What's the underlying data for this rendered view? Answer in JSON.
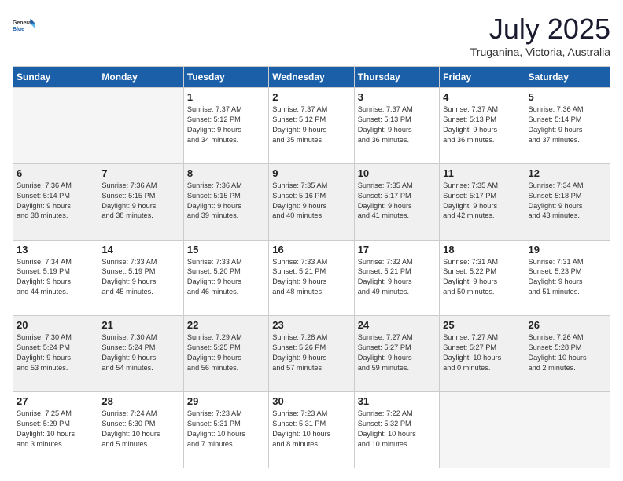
{
  "header": {
    "logo_line1": "General",
    "logo_line2": "Blue",
    "month_title": "July 2025",
    "location": "Truganina, Victoria, Australia"
  },
  "days_of_week": [
    "Sunday",
    "Monday",
    "Tuesday",
    "Wednesday",
    "Thursday",
    "Friday",
    "Saturday"
  ],
  "weeks": [
    [
      {
        "day": "",
        "info": ""
      },
      {
        "day": "",
        "info": ""
      },
      {
        "day": "1",
        "info": "Sunrise: 7:37 AM\nSunset: 5:12 PM\nDaylight: 9 hours\nand 34 minutes."
      },
      {
        "day": "2",
        "info": "Sunrise: 7:37 AM\nSunset: 5:12 PM\nDaylight: 9 hours\nand 35 minutes."
      },
      {
        "day": "3",
        "info": "Sunrise: 7:37 AM\nSunset: 5:13 PM\nDaylight: 9 hours\nand 36 minutes."
      },
      {
        "day": "4",
        "info": "Sunrise: 7:37 AM\nSunset: 5:13 PM\nDaylight: 9 hours\nand 36 minutes."
      },
      {
        "day": "5",
        "info": "Sunrise: 7:36 AM\nSunset: 5:14 PM\nDaylight: 9 hours\nand 37 minutes."
      }
    ],
    [
      {
        "day": "6",
        "info": "Sunrise: 7:36 AM\nSunset: 5:14 PM\nDaylight: 9 hours\nand 38 minutes."
      },
      {
        "day": "7",
        "info": "Sunrise: 7:36 AM\nSunset: 5:15 PM\nDaylight: 9 hours\nand 38 minutes."
      },
      {
        "day": "8",
        "info": "Sunrise: 7:36 AM\nSunset: 5:15 PM\nDaylight: 9 hours\nand 39 minutes."
      },
      {
        "day": "9",
        "info": "Sunrise: 7:35 AM\nSunset: 5:16 PM\nDaylight: 9 hours\nand 40 minutes."
      },
      {
        "day": "10",
        "info": "Sunrise: 7:35 AM\nSunset: 5:17 PM\nDaylight: 9 hours\nand 41 minutes."
      },
      {
        "day": "11",
        "info": "Sunrise: 7:35 AM\nSunset: 5:17 PM\nDaylight: 9 hours\nand 42 minutes."
      },
      {
        "day": "12",
        "info": "Sunrise: 7:34 AM\nSunset: 5:18 PM\nDaylight: 9 hours\nand 43 minutes."
      }
    ],
    [
      {
        "day": "13",
        "info": "Sunrise: 7:34 AM\nSunset: 5:19 PM\nDaylight: 9 hours\nand 44 minutes."
      },
      {
        "day": "14",
        "info": "Sunrise: 7:33 AM\nSunset: 5:19 PM\nDaylight: 9 hours\nand 45 minutes."
      },
      {
        "day": "15",
        "info": "Sunrise: 7:33 AM\nSunset: 5:20 PM\nDaylight: 9 hours\nand 46 minutes."
      },
      {
        "day": "16",
        "info": "Sunrise: 7:33 AM\nSunset: 5:21 PM\nDaylight: 9 hours\nand 48 minutes."
      },
      {
        "day": "17",
        "info": "Sunrise: 7:32 AM\nSunset: 5:21 PM\nDaylight: 9 hours\nand 49 minutes."
      },
      {
        "day": "18",
        "info": "Sunrise: 7:31 AM\nSunset: 5:22 PM\nDaylight: 9 hours\nand 50 minutes."
      },
      {
        "day": "19",
        "info": "Sunrise: 7:31 AM\nSunset: 5:23 PM\nDaylight: 9 hours\nand 51 minutes."
      }
    ],
    [
      {
        "day": "20",
        "info": "Sunrise: 7:30 AM\nSunset: 5:24 PM\nDaylight: 9 hours\nand 53 minutes."
      },
      {
        "day": "21",
        "info": "Sunrise: 7:30 AM\nSunset: 5:24 PM\nDaylight: 9 hours\nand 54 minutes."
      },
      {
        "day": "22",
        "info": "Sunrise: 7:29 AM\nSunset: 5:25 PM\nDaylight: 9 hours\nand 56 minutes."
      },
      {
        "day": "23",
        "info": "Sunrise: 7:28 AM\nSunset: 5:26 PM\nDaylight: 9 hours\nand 57 minutes."
      },
      {
        "day": "24",
        "info": "Sunrise: 7:27 AM\nSunset: 5:27 PM\nDaylight: 9 hours\nand 59 minutes."
      },
      {
        "day": "25",
        "info": "Sunrise: 7:27 AM\nSunset: 5:27 PM\nDaylight: 10 hours\nand 0 minutes."
      },
      {
        "day": "26",
        "info": "Sunrise: 7:26 AM\nSunset: 5:28 PM\nDaylight: 10 hours\nand 2 minutes."
      }
    ],
    [
      {
        "day": "27",
        "info": "Sunrise: 7:25 AM\nSunset: 5:29 PM\nDaylight: 10 hours\nand 3 minutes."
      },
      {
        "day": "28",
        "info": "Sunrise: 7:24 AM\nSunset: 5:30 PM\nDaylight: 10 hours\nand 5 minutes."
      },
      {
        "day": "29",
        "info": "Sunrise: 7:23 AM\nSunset: 5:31 PM\nDaylight: 10 hours\nand 7 minutes."
      },
      {
        "day": "30",
        "info": "Sunrise: 7:23 AM\nSunset: 5:31 PM\nDaylight: 10 hours\nand 8 minutes."
      },
      {
        "day": "31",
        "info": "Sunrise: 7:22 AM\nSunset: 5:32 PM\nDaylight: 10 hours\nand 10 minutes."
      },
      {
        "day": "",
        "info": ""
      },
      {
        "day": "",
        "info": ""
      }
    ]
  ],
  "row_colors": [
    "#ffffff",
    "#f0f0f0",
    "#ffffff",
    "#f0f0f0",
    "#ffffff"
  ]
}
